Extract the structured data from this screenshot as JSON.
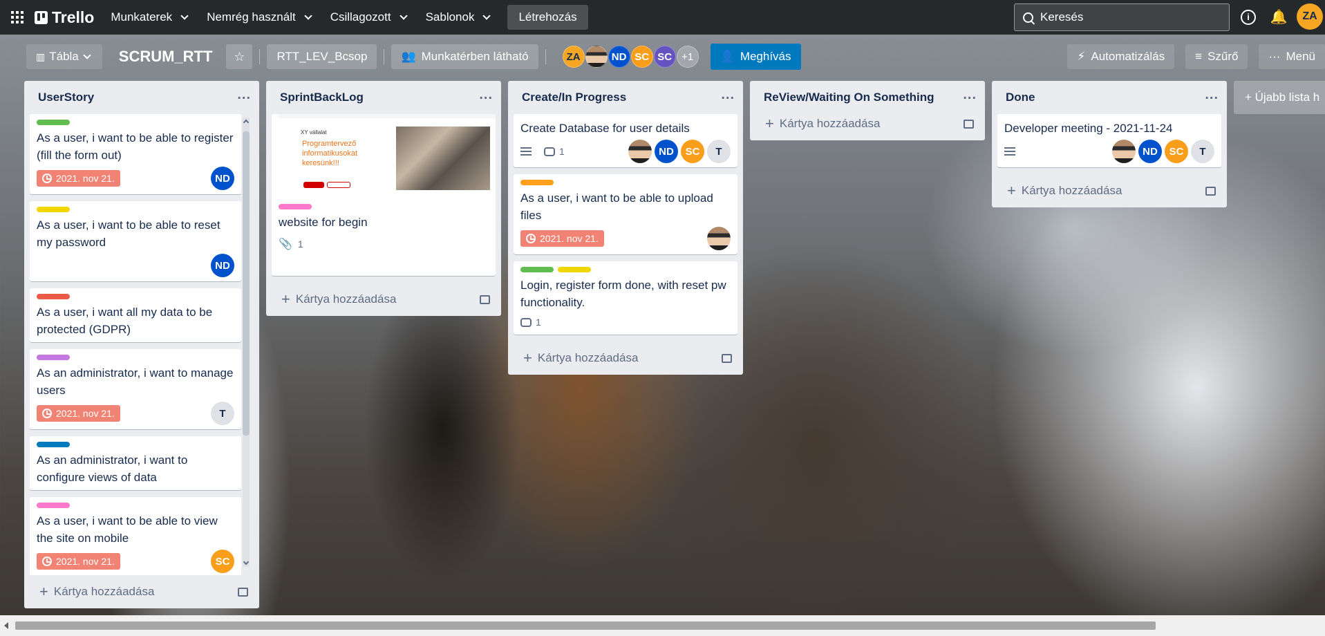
{
  "topbar": {
    "logo": "Trello",
    "nav": [
      "Munkaterek",
      "Nemrég használt",
      "Csillagozott",
      "Sablonok"
    ],
    "create": "Létrehozás",
    "search_placeholder": "Keresés",
    "user_initials": "ZA"
  },
  "board": {
    "view": "Tábla",
    "title": "SCRUM_RTT",
    "workspace": "RTT_LEV_Bcsop",
    "visibility": "Munkatérben látható",
    "members": [
      "ZA",
      "",
      "ND",
      "SC",
      "SC"
    ],
    "more_members": "+1",
    "invite": "Meghívás",
    "automation": "Automatizálás",
    "filter": "Szűrő",
    "menu": "Menü"
  },
  "add_card": "Kártya hozzáadása",
  "new_list": "+ Újabb lista h",
  "lists": [
    {
      "title": "UserStory",
      "cards": [
        {
          "labels": [
            "#61bd4f"
          ],
          "title": "As a user, i want to be able to register (fill the form out)",
          "due": "2021. nov 21.",
          "members": [
            "ND"
          ]
        },
        {
          "labels": [
            "#f2d600"
          ],
          "title": "As a user, i want to be able to reset my password",
          "due": "",
          "members": [
            "ND"
          ]
        },
        {
          "labels": [
            "#eb5a46"
          ],
          "title": "As a user, i want all my data to be protected (GDPR)",
          "due": "",
          "members": []
        },
        {
          "labels": [
            "#c377e0"
          ],
          "title": "As an administrator, i want to manage users",
          "due": "2021. nov 21.",
          "members": [
            "T"
          ]
        },
        {
          "labels": [
            "#0079bf"
          ],
          "title": "As an administrator, i want to configure views of data",
          "due": "",
          "members": []
        },
        {
          "labels": [
            "#ff78cb"
          ],
          "title": "As a user, i want to be able to view the site on mobile",
          "due": "2021. nov 21.",
          "members": [
            "SC"
          ]
        }
      ]
    },
    {
      "title": "SprintBackLog",
      "cards": [
        {
          "cover": {
            "small": "XY vállalat",
            "headline": "Programtervező informatikusokat keresünk!!!"
          },
          "labels": [
            "#ff78cb"
          ],
          "title": "website for begin",
          "attachments": "1"
        }
      ]
    },
    {
      "title": "Create/In Progress",
      "cards": [
        {
          "labels": [],
          "title": "Create Database for user details",
          "comments": "1",
          "members": [
            "",
            "ND",
            "SC",
            "T"
          ]
        },
        {
          "labels": [
            "#ff9f1a"
          ],
          "title": "As a user, i want to be able to upload files",
          "due": "2021. nov 21.",
          "members": [
            ""
          ]
        },
        {
          "labels": [
            "#61bd4f",
            "#f2d600"
          ],
          "title": "Login, register form done, with reset pw functionality.",
          "comments": "1",
          "members": []
        }
      ]
    },
    {
      "title": "ReView/Waiting On Something",
      "cards": []
    },
    {
      "title": "Done",
      "cards": [
        {
          "labels": [],
          "title": "Developer meeting - 2021-11-24",
          "members": [
            "",
            "ND",
            "SC",
            "T"
          ]
        }
      ]
    }
  ]
}
